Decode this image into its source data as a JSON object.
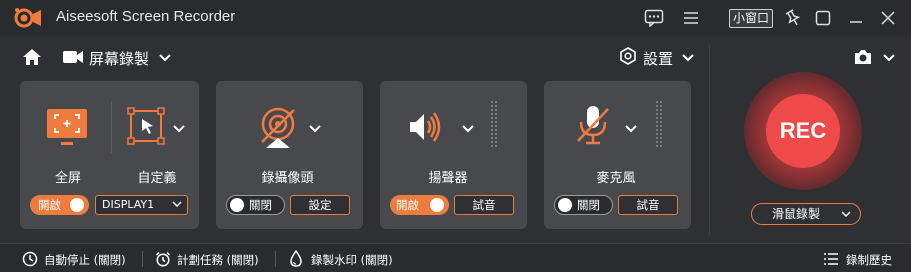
{
  "window": {
    "title": "Aiseesoft Screen Recorder",
    "mini_label": "小窗口"
  },
  "nav": {
    "mode_label": "屏幕錄製",
    "settings_label": "設置"
  },
  "screen_card": {
    "fullscreen_label": "全屏",
    "custom_label": "自定義",
    "toggle_label": "開啟",
    "toggle_on": true,
    "display_value": "DISPLAY1"
  },
  "webcam_card": {
    "label": "錄攝像頭",
    "toggle_label": "關閉",
    "toggle_on": false,
    "settings_button": "設定"
  },
  "speaker_card": {
    "label": "揚聲器",
    "toggle_label": "開啟",
    "toggle_on": true,
    "test_button": "試音"
  },
  "mic_card": {
    "label": "麥克風",
    "toggle_label": "關閉",
    "toggle_on": false,
    "test_button": "試音"
  },
  "record": {
    "rec_label": "REC",
    "mouse_record_label": "滑鼠錄製"
  },
  "bottom": {
    "auto_stop": "自動停止 (關閉)",
    "schedule": "計劃任務 (關閉)",
    "watermark": "錄製水印 (關閉)",
    "history": "錄制歷史"
  },
  "colors": {
    "accent": "#f07b3f",
    "rec": "#ef4a4a",
    "background": "#2f3033",
    "card": "#48494d"
  }
}
